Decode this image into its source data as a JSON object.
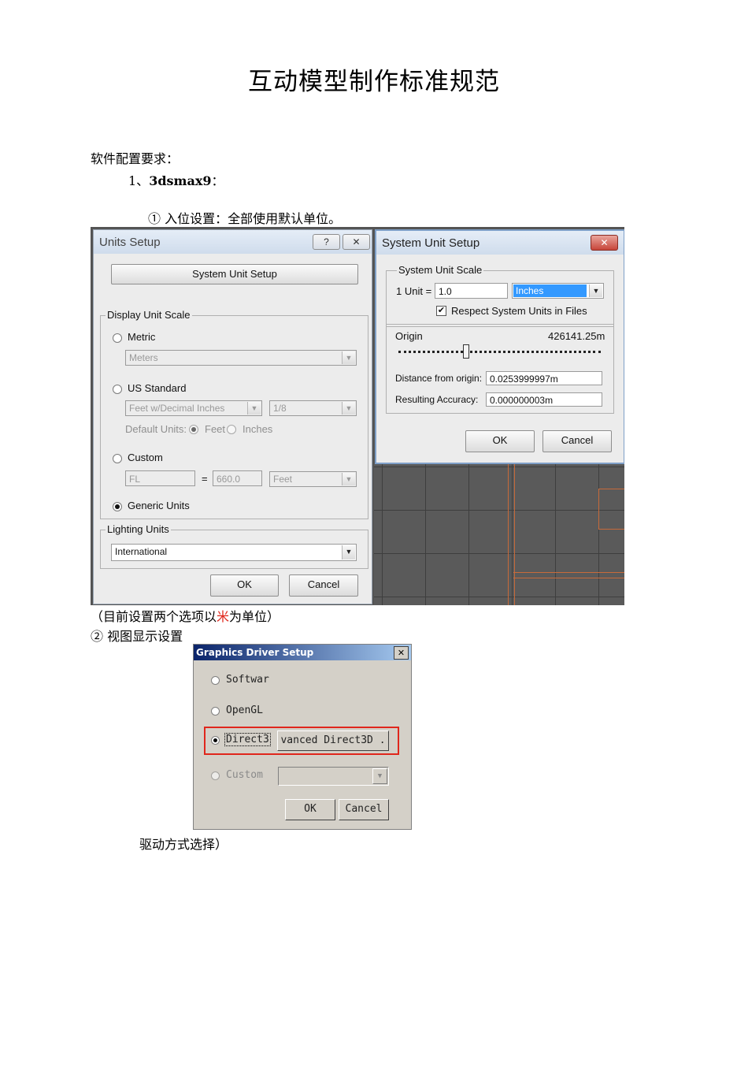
{
  "doc": {
    "title": "互动模型制作标准规范",
    "section": "软件配置要求：",
    "item_number": "1、",
    "item_name": "3dsmax9",
    "item_colon": "：",
    "sub1": "① 入位设置：全部使用默认单位。",
    "caption1_pre": "（目前设置两个选项以",
    "caption1_red": "米",
    "caption1_post": "为单位）",
    "sub2": "② 视图显示设置",
    "caption2": "驱动方式选择）"
  },
  "units_setup": {
    "title": "Units Setup",
    "help_glyph": "?",
    "close_glyph": "✕",
    "system_button": "System Unit Setup",
    "display_group": "Display Unit Scale",
    "metric": "Metric",
    "metric_value": "Meters",
    "us_standard": "US Standard",
    "us_value": "Feet w/Decimal Inches",
    "us_fraction": "1/8",
    "default_units_label": "Default Units:",
    "feet": "Feet",
    "inches": "Inches",
    "custom": "Custom",
    "custom_name": "FL",
    "equals": "=",
    "custom_value": "660.0",
    "custom_unit": "Feet",
    "generic": "Generic Units",
    "lighting_group": "Lighting Units",
    "lighting_value": "International",
    "ok": "OK",
    "cancel": "Cancel",
    "selected": "generic"
  },
  "system_unit_setup": {
    "title": "System Unit Setup",
    "close_glyph": "✕",
    "scale_group": "System Unit Scale",
    "unit_label": "1 Unit =",
    "unit_value": "1.0",
    "unit_type": "Inches",
    "respect_label": "Respect System Units in Files",
    "respect_checked": true,
    "origin_label": "Origin",
    "origin_value": "426141.25m",
    "distance_label": "Distance from origin:",
    "distance_value": "0.0253999997m",
    "accuracy_label": "Resulting Accuracy:",
    "accuracy_value": "0.000000003m",
    "ok": "OK",
    "cancel": "Cancel",
    "accent": "#3399ff",
    "close_color": "#c7453a"
  },
  "graphics_driver": {
    "title": "Graphics Driver Setup",
    "close_glyph": "✕",
    "software": "Softwar",
    "opengl": "OpenGL",
    "direct3d": "Direct3",
    "advanced": "vanced Direct3D .",
    "custom": "Custom",
    "ok": "OK",
    "cancel": "Cancel",
    "selected": "direct3d",
    "highlight_color": "#e0261c"
  }
}
